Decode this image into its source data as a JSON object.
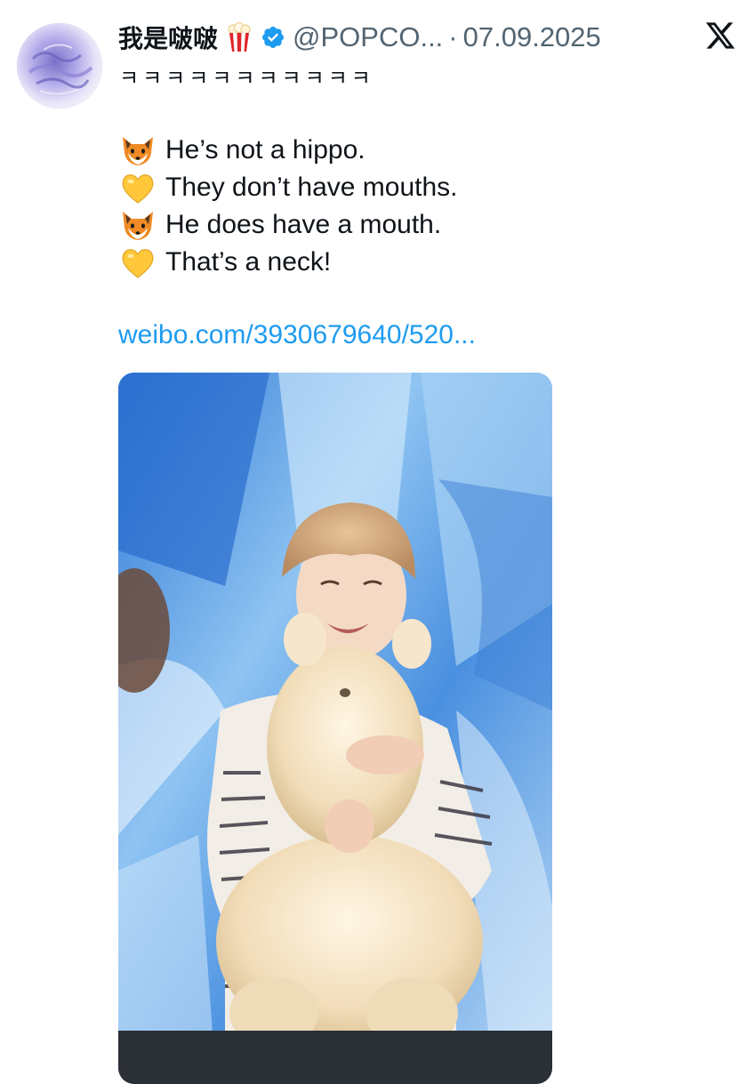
{
  "tweet": {
    "author": {
      "display_name": "我是啵啵",
      "handle": "@POPCO...",
      "name_emoji_icon": "popcorn-icon",
      "verified_icon": "verified-badge-icon"
    },
    "separator": "·",
    "date": "07.09.2025",
    "platform_logo": "x-logo-icon",
    "subline": "ㅋㅋㅋㅋㅋㅋㅋㅋㅋㅋㅋ",
    "lines": [
      {
        "icon": "fox-face-icon",
        "text": "He’s not a hippo."
      },
      {
        "icon": "yellow-heart-icon",
        "text": "They don’t have mouths."
      },
      {
        "icon": "fox-face-icon",
        "text": "He does have a mouth."
      },
      {
        "icon": "yellow-heart-icon",
        "text": "That’s a neck!"
      }
    ],
    "link": "weibo.com/3930679640/520...",
    "media": {
      "description_icon": "photo-person-with-plush-icon"
    }
  },
  "colors": {
    "text_primary": "#0f1419",
    "text_secondary": "#536471",
    "link": "#1d9bf0",
    "verified": "#1d9bf0"
  }
}
